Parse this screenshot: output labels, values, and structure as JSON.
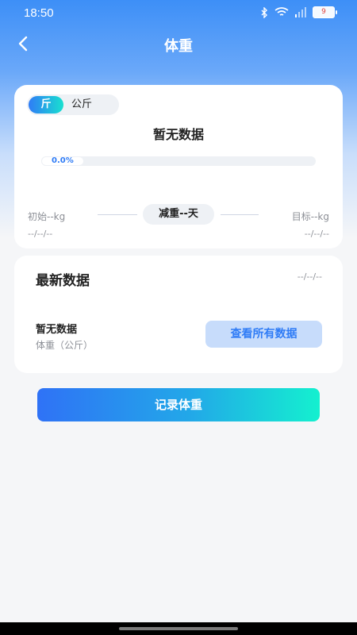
{
  "status_bar": {
    "time": "18:50",
    "battery_level": "9",
    "icons": [
      "bluetooth-icon",
      "wifi-icon",
      "signal-icon",
      "battery-icon"
    ]
  },
  "nav": {
    "back_icon": "chevron-left-icon",
    "title": "体重"
  },
  "summary": {
    "unit_options": [
      "斤",
      "公斤"
    ],
    "selected_unit": "斤",
    "status_title": "暂无数据",
    "progress_label": "0.0%",
    "progress_value": 0.0,
    "start_label": "初始--kg",
    "loss_label": "减重--天",
    "target_label": "目标--kg",
    "start_date": "--/--/--",
    "target_date": "--/--/--"
  },
  "latest": {
    "title": "最新数据",
    "date": "--/--/--",
    "value": "暂无数据",
    "unit_label": "体重（公斤）",
    "view_all_label": "查看所有数据"
  },
  "actions": {
    "record_label": "记录体重"
  },
  "colors": {
    "accent": "#2f7cf6",
    "gradient_end": "#14f0cf",
    "header_blue": "#3d8ff7"
  }
}
